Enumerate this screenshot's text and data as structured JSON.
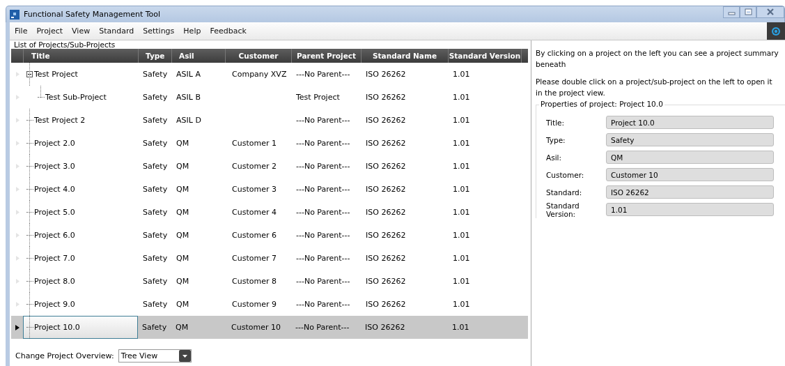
{
  "window": {
    "title": "Functional Safety Management Tool"
  },
  "menu": [
    "File",
    "Project",
    "View",
    "Standard",
    "Settings",
    "Help",
    "Feedback"
  ],
  "project_list": {
    "title": "List of Projects/Sub-Projects",
    "columns": [
      "Title",
      "Type",
      "Asil",
      "Customer",
      "Parent Project",
      "Standard Name",
      "Standard Version"
    ],
    "rows": [
      {
        "cells": [
          "Test Project",
          "Safety",
          "ASIL A",
          "Company XVZ",
          "---No Parent---",
          "ISO 26262",
          "1.01"
        ],
        "selected": false,
        "expanded": true,
        "children": [
          {
            "cells": [
              "Test Sub-Project",
              "Safety",
              "ASIL B",
              "",
              "Test Project",
              "ISO 26262",
              "1.01"
            ],
            "selected": false
          }
        ]
      },
      {
        "cells": [
          "Test Project 2",
          "Safety",
          "ASIL D",
          "",
          "---No Parent---",
          "ISO 26262",
          "1.01"
        ],
        "selected": false
      },
      {
        "cells": [
          "Project 2.0",
          "Safety",
          "QM",
          "Customer 1",
          "---No Parent---",
          "ISO 26262",
          "1.01"
        ],
        "selected": false
      },
      {
        "cells": [
          "Project 3.0",
          "Safety",
          "QM",
          "Customer 2",
          "---No Parent---",
          "ISO 26262",
          "1.01"
        ],
        "selected": false
      },
      {
        "cells": [
          "Project 4.0",
          "Safety",
          "QM",
          "Customer 3",
          "---No Parent---",
          "ISO 26262",
          "1.01"
        ],
        "selected": false
      },
      {
        "cells": [
          "Project 5.0",
          "Safety",
          "QM",
          "Customer 4",
          "---No Parent---",
          "ISO 26262",
          "1.01"
        ],
        "selected": false
      },
      {
        "cells": [
          "Project 6.0",
          "Safety",
          "QM",
          "Customer 6",
          "---No Parent---",
          "ISO 26262",
          "1.01"
        ],
        "selected": false
      },
      {
        "cells": [
          "Project 7.0",
          "Safety",
          "QM",
          "Customer 7",
          "---No Parent---",
          "ISO 26262",
          "1.01"
        ],
        "selected": false
      },
      {
        "cells": [
          "Project 8.0",
          "Safety",
          "QM",
          "Customer 8",
          "---No Parent---",
          "ISO 26262",
          "1.01"
        ],
        "selected": false
      },
      {
        "cells": [
          "Project 9.0",
          "Safety",
          "QM",
          "Customer 9",
          "---No Parent---",
          "ISO 26262",
          "1.01"
        ],
        "selected": false
      },
      {
        "cells": [
          "Project 10.0",
          "Safety",
          "QM",
          "Customer 10",
          "---No Parent---",
          "ISO 26262",
          "1.01"
        ],
        "selected": true
      }
    ]
  },
  "overview": {
    "label": "Change Project Overview:",
    "value": "Tree View"
  },
  "info": [
    "By clicking on a project on the left you can see a project summary beneath",
    "Please double click on a project/sub-project on the left to open it in the project view."
  ],
  "properties": {
    "title": "Properties of project: Project 10.0",
    "fields": [
      {
        "label": "Title:",
        "value": "Project 10.0"
      },
      {
        "label": "Type:",
        "value": "Safety"
      },
      {
        "label": "Asil:",
        "value": "QM"
      },
      {
        "label": "Customer:",
        "value": "Customer 10"
      },
      {
        "label": "Standard:",
        "value": "ISO 26262"
      },
      {
        "label": "Standard Version:",
        "value": "1.01"
      }
    ]
  }
}
